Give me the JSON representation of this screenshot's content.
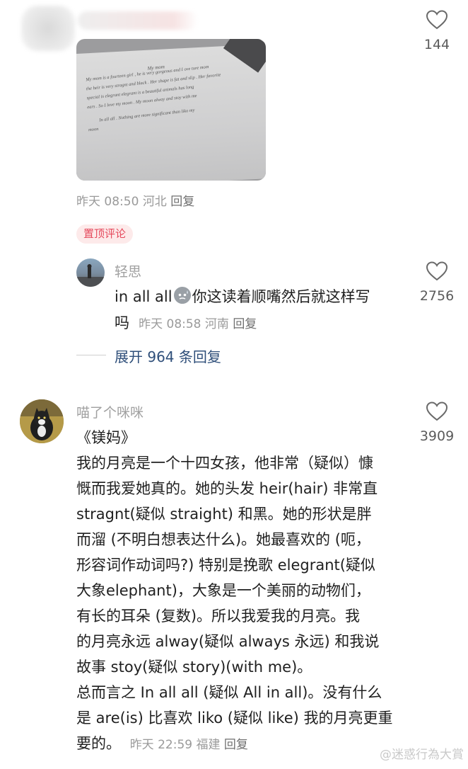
{
  "top_comment": {
    "likes": "144",
    "photo_handwriting": {
      "title": "My mom",
      "lines": [
        "My mom is a fourteen girl , he is very gorgeous and I ove ture mom",
        "the heir is very stragnt and black . Her shape is fat and slip . Her favorite",
        "special is elegrant      elegrant is a beautiful animals has long",
        "ears .  So I love my moon . My moon alway and stoy with me",
        "In all all .  Nothing are more significant than liko my",
        "moon"
      ]
    },
    "meta": {
      "time": "昨天 08:50",
      "location": "河北",
      "reply": "回复"
    }
  },
  "pinned_badge": "置顶评论",
  "reply_comment": {
    "username": "轻思",
    "text_line1_prefix": "in all all",
    "text_line1_suffix": "你这读着顺嘴然后就这样写",
    "text_line2": "吗",
    "meta": {
      "time": "昨天 08:58",
      "location": "河南",
      "reply": "回复"
    },
    "likes": "2756",
    "expand_label": "展开 964 条回复"
  },
  "main_comment": {
    "username": "喵了个咪咪",
    "likes": "3909",
    "lines": [
      "《镁妈》",
      "我的月亮是一个十四女孩，他非常（疑似）慷",
      "慨而我爱她真的。她的头发 heir(hair) 非常直",
      "stragnt(疑似 straight) 和黑。她的形状是胖",
      "而溜 (不明白想表达什么)。她最喜欢的 (呃，",
      "形容词作动词吗?) 特别是挽歌 elegrant(疑似",
      "大象elephant)，大象是一个美丽的动物们，",
      "有长的耳朵 (复数)。所以我爱我的月亮。我",
      "的月亮永远 alway(疑似 always 永远) 和我说",
      "故事 stoy(疑似 story)(with me)。",
      "总而言之 In all all (疑似 All in all)。没有什么",
      "是 are(is) 比喜欢 liko (疑似 like) 我的月亮更重"
    ],
    "last_line_text": "要的。",
    "meta": {
      "time": "昨天 22:59",
      "location": "福建",
      "reply": "回复"
    }
  },
  "watermark": "@迷惑行為大賞",
  "colors": {
    "accent_red": "#e5495c",
    "link_blue": "#2f4f7a",
    "meta_gray": "#9a9a9a"
  }
}
